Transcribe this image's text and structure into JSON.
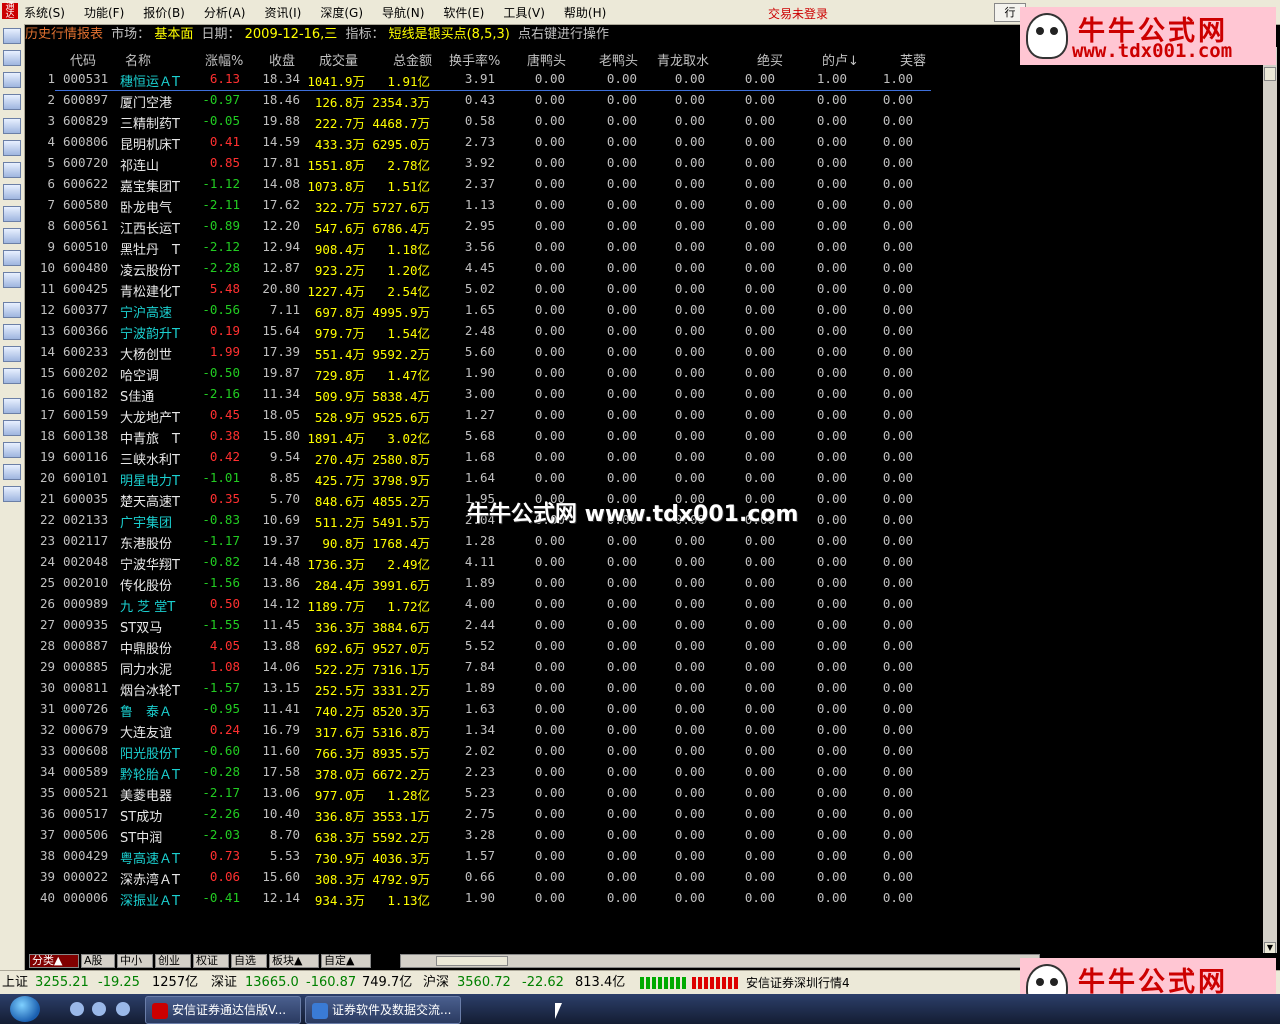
{
  "menu": {
    "items": [
      "系统(S)",
      "功能(F)",
      "报价(B)",
      "分析(A)",
      "资讯(I)",
      "深度(G)",
      "导航(N)",
      "软件(E)",
      "工具(V)",
      "帮助(H)"
    ],
    "login_status": "交易未登录",
    "row_button": "行"
  },
  "infobar": {
    "report_name": "历史行情报表",
    "market_label": "市场：",
    "market_value": "基本面",
    "date_label": "日期：",
    "date_value": "2009-12-16,三",
    "indicator_label": "指标：",
    "indicator_value": "短线是银买点(8,5,3)",
    "hint": "点右键进行操作"
  },
  "table": {
    "headers": [
      "代码",
      "名称",
      "涨幅%",
      "收盘",
      "成交量",
      "总金额",
      "换手率%",
      "唐鸭头",
      "老鸭头",
      "青龙取水",
      "绝买",
      "的卢↓",
      "芙蓉"
    ],
    "rows": [
      [
        "1",
        "000531",
        "穗恒运ＡT",
        "6.13",
        "18.34",
        "1041.9万",
        "1.91亿",
        "3.91",
        "0.00",
        "0.00",
        "0.00",
        "0.00",
        "1.00",
        "1.00"
      ],
      [
        "2",
        "600897",
        "厦门空港",
        "-0.97",
        "18.46",
        "126.8万",
        "2354.3万",
        "0.43",
        "0.00",
        "0.00",
        "0.00",
        "0.00",
        "0.00",
        "0.00"
      ],
      [
        "3",
        "600829",
        "三精制药T",
        "-0.05",
        "19.88",
        "222.7万",
        "4468.7万",
        "0.58",
        "0.00",
        "0.00",
        "0.00",
        "0.00",
        "0.00",
        "0.00"
      ],
      [
        "4",
        "600806",
        "昆明机床T",
        "0.41",
        "14.59",
        "433.3万",
        "6295.0万",
        "2.73",
        "0.00",
        "0.00",
        "0.00",
        "0.00",
        "0.00",
        "0.00"
      ],
      [
        "5",
        "600720",
        "祁连山",
        "0.85",
        "17.81",
        "1551.8万",
        "2.78亿",
        "3.92",
        "0.00",
        "0.00",
        "0.00",
        "0.00",
        "0.00",
        "0.00"
      ],
      [
        "6",
        "600622",
        "嘉宝集团T",
        "-1.12",
        "14.08",
        "1073.8万",
        "1.51亿",
        "2.37",
        "0.00",
        "0.00",
        "0.00",
        "0.00",
        "0.00",
        "0.00"
      ],
      [
        "7",
        "600580",
        "卧龙电气",
        "-2.11",
        "17.62",
        "322.7万",
        "5727.6万",
        "1.13",
        "0.00",
        "0.00",
        "0.00",
        "0.00",
        "0.00",
        "0.00"
      ],
      [
        "8",
        "600561",
        "江西长运T",
        "-0.89",
        "12.20",
        "547.6万",
        "6786.4万",
        "2.95",
        "0.00",
        "0.00",
        "0.00",
        "0.00",
        "0.00",
        "0.00"
      ],
      [
        "9",
        "600510",
        "黑牡丹　T",
        "-2.12",
        "12.94",
        "908.4万",
        "1.18亿",
        "3.56",
        "0.00",
        "0.00",
        "0.00",
        "0.00",
        "0.00",
        "0.00"
      ],
      [
        "10",
        "600480",
        "凌云股份T",
        "-2.28",
        "12.87",
        "923.2万",
        "1.20亿",
        "4.45",
        "0.00",
        "0.00",
        "0.00",
        "0.00",
        "0.00",
        "0.00"
      ],
      [
        "11",
        "600425",
        "青松建化T",
        "5.48",
        "20.80",
        "1227.4万",
        "2.54亿",
        "5.02",
        "0.00",
        "0.00",
        "0.00",
        "0.00",
        "0.00",
        "0.00"
      ],
      [
        "12",
        "600377",
        "宁沪高速",
        "-0.56",
        "7.11",
        "697.8万",
        "4995.9万",
        "1.65",
        "0.00",
        "0.00",
        "0.00",
        "0.00",
        "0.00",
        "0.00"
      ],
      [
        "13",
        "600366",
        "宁波韵升T",
        "0.19",
        "15.64",
        "979.7万",
        "1.54亿",
        "2.48",
        "0.00",
        "0.00",
        "0.00",
        "0.00",
        "0.00",
        "0.00"
      ],
      [
        "14",
        "600233",
        "大杨创世",
        "1.99",
        "17.39",
        "551.4万",
        "9592.2万",
        "5.60",
        "0.00",
        "0.00",
        "0.00",
        "0.00",
        "0.00",
        "0.00"
      ],
      [
        "15",
        "600202",
        "哈空调",
        "-0.50",
        "19.87",
        "729.8万",
        "1.47亿",
        "1.90",
        "0.00",
        "0.00",
        "0.00",
        "0.00",
        "0.00",
        "0.00"
      ],
      [
        "16",
        "600182",
        "S佳通",
        "-2.16",
        "11.34",
        "509.9万",
        "5838.4万",
        "3.00",
        "0.00",
        "0.00",
        "0.00",
        "0.00",
        "0.00",
        "0.00"
      ],
      [
        "17",
        "600159",
        "大龙地产T",
        "0.45",
        "18.05",
        "528.9万",
        "9525.6万",
        "1.27",
        "0.00",
        "0.00",
        "0.00",
        "0.00",
        "0.00",
        "0.00"
      ],
      [
        "18",
        "600138",
        "中青旅　T",
        "0.38",
        "15.80",
        "1891.4万",
        "3.02亿",
        "5.68",
        "0.00",
        "0.00",
        "0.00",
        "0.00",
        "0.00",
        "0.00"
      ],
      [
        "19",
        "600116",
        "三峡水利T",
        "0.42",
        "9.54",
        "270.4万",
        "2580.8万",
        "1.68",
        "0.00",
        "0.00",
        "0.00",
        "0.00",
        "0.00",
        "0.00"
      ],
      [
        "20",
        "600101",
        "明星电力T",
        "-1.01",
        "8.85",
        "425.7万",
        "3798.9万",
        "1.64",
        "0.00",
        "0.00",
        "0.00",
        "0.00",
        "0.00",
        "0.00"
      ],
      [
        "21",
        "600035",
        "楚天高速T",
        "0.35",
        "5.70",
        "848.6万",
        "4855.2万",
        "1.95",
        "0.00",
        "0.00",
        "0.00",
        "0.00",
        "0.00",
        "0.00"
      ],
      [
        "22",
        "002133",
        "广宇集团",
        "-0.83",
        "10.69",
        "511.2万",
        "5491.5万",
        "2.04",
        "0.00",
        "0.00",
        "0.00",
        "0.00",
        "0.00",
        "0.00"
      ],
      [
        "23",
        "002117",
        "东港股份",
        "-1.17",
        "19.37",
        "90.8万",
        "1768.4万",
        "1.28",
        "0.00",
        "0.00",
        "0.00",
        "0.00",
        "0.00",
        "0.00"
      ],
      [
        "24",
        "002048",
        "宁波华翔T",
        "-0.82",
        "14.48",
        "1736.3万",
        "2.49亿",
        "4.11",
        "0.00",
        "0.00",
        "0.00",
        "0.00",
        "0.00",
        "0.00"
      ],
      [
        "25",
        "002010",
        "传化股份",
        "-1.56",
        "13.86",
        "284.4万",
        "3991.6万",
        "1.89",
        "0.00",
        "0.00",
        "0.00",
        "0.00",
        "0.00",
        "0.00"
      ],
      [
        "26",
        "000989",
        "九 芝 堂T",
        "0.50",
        "14.12",
        "1189.7万",
        "1.72亿",
        "4.00",
        "0.00",
        "0.00",
        "0.00",
        "0.00",
        "0.00",
        "0.00"
      ],
      [
        "27",
        "000935",
        "ST双马",
        "-1.55",
        "11.45",
        "336.3万",
        "3884.6万",
        "2.44",
        "0.00",
        "0.00",
        "0.00",
        "0.00",
        "0.00",
        "0.00"
      ],
      [
        "28",
        "000887",
        "中鼎股份",
        "4.05",
        "13.88",
        "692.6万",
        "9527.0万",
        "5.52",
        "0.00",
        "0.00",
        "0.00",
        "0.00",
        "0.00",
        "0.00"
      ],
      [
        "29",
        "000885",
        "同力水泥",
        "1.08",
        "14.06",
        "522.2万",
        "7316.1万",
        "7.84",
        "0.00",
        "0.00",
        "0.00",
        "0.00",
        "0.00",
        "0.00"
      ],
      [
        "30",
        "000811",
        "烟台冰轮T",
        "-1.57",
        "13.15",
        "252.5万",
        "3331.2万",
        "1.89",
        "0.00",
        "0.00",
        "0.00",
        "0.00",
        "0.00",
        "0.00"
      ],
      [
        "31",
        "000726",
        "鲁　泰Ａ",
        "-0.95",
        "11.41",
        "740.2万",
        "8520.3万",
        "1.63",
        "0.00",
        "0.00",
        "0.00",
        "0.00",
        "0.00",
        "0.00"
      ],
      [
        "32",
        "000679",
        "大连友谊",
        "0.24",
        "16.79",
        "317.6万",
        "5316.8万",
        "1.34",
        "0.00",
        "0.00",
        "0.00",
        "0.00",
        "0.00",
        "0.00"
      ],
      [
        "33",
        "000608",
        "阳光股份T",
        "-0.60",
        "11.60",
        "766.3万",
        "8935.5万",
        "2.02",
        "0.00",
        "0.00",
        "0.00",
        "0.00",
        "0.00",
        "0.00"
      ],
      [
        "34",
        "000589",
        "黔轮胎ＡT",
        "-0.28",
        "17.58",
        "378.0万",
        "6672.2万",
        "2.23",
        "0.00",
        "0.00",
        "0.00",
        "0.00",
        "0.00",
        "0.00"
      ],
      [
        "35",
        "000521",
        "美菱电器",
        "-2.17",
        "13.06",
        "977.0万",
        "1.28亿",
        "5.23",
        "0.00",
        "0.00",
        "0.00",
        "0.00",
        "0.00",
        "0.00"
      ],
      [
        "36",
        "000517",
        "ST成功",
        "-2.26",
        "10.40",
        "336.8万",
        "3553.1万",
        "2.75",
        "0.00",
        "0.00",
        "0.00",
        "0.00",
        "0.00",
        "0.00"
      ],
      [
        "37",
        "000506",
        "ST中润",
        "-2.03",
        "8.70",
        "638.3万",
        "5592.2万",
        "3.28",
        "0.00",
        "0.00",
        "0.00",
        "0.00",
        "0.00",
        "0.00"
      ],
      [
        "38",
        "000429",
        "粤高速ＡT",
        "0.73",
        "5.53",
        "730.9万",
        "4036.3万",
        "1.57",
        "0.00",
        "0.00",
        "0.00",
        "0.00",
        "0.00",
        "0.00"
      ],
      [
        "39",
        "000022",
        "深赤湾ＡT",
        "0.06",
        "15.60",
        "308.3万",
        "4792.9万",
        "0.66",
        "0.00",
        "0.00",
        "0.00",
        "0.00",
        "0.00",
        "0.00"
      ],
      [
        "40",
        "000006",
        "深振业ＡT",
        "-0.41",
        "12.14",
        "934.3万",
        "1.13亿",
        "1.90",
        "0.00",
        "0.00",
        "0.00",
        "0.00",
        "0.00",
        "0.00"
      ]
    ],
    "highlight_names": [
      "穗恒运ＡT",
      "宁沪高速",
      "宁波韵升T",
      "明星电力T",
      "广宇集团",
      "九 芝 堂T",
      "鲁　泰Ａ",
      "阳光股份T",
      "黔轮胎ＡT",
      "粤高速ＡT",
      "深振业ＡT"
    ]
  },
  "watermark_text": "牛牛公式网 www.tdx001.com",
  "tabs": [
    "分类▲",
    "A股",
    "中小",
    "创业",
    "权证",
    "自选",
    "板块▲",
    "自定▲"
  ],
  "status": {
    "sh_label": "上证",
    "sh_value": "3255.21",
    "sh_change": "-19.25",
    "sh_amount": "1257亿",
    "sz_label": "深证",
    "sz_value": "13665.0",
    "sz_change": "-160.87",
    "sz_amount": "749.7亿",
    "hs_label": "沪深",
    "hs_value": "3560.72",
    "hs_change": "-22.62",
    "hs_amount": "813.4亿",
    "server": "安信证券深圳行情4"
  },
  "brand": {
    "name": "牛牛公式网",
    "url": "www.tdx001.com"
  },
  "taskbar": {
    "task1": "安信证券通达信版V...",
    "task2": "证券软件及数据交流..."
  },
  "colors": {
    "up": "#ff3030",
    "down": "#22cc22",
    "yellow": "#ffff00",
    "cyan": "#00cccc",
    "gray": "#c0c0c0",
    "teal": "#1bd0d0",
    "report_title": "#e07030"
  }
}
